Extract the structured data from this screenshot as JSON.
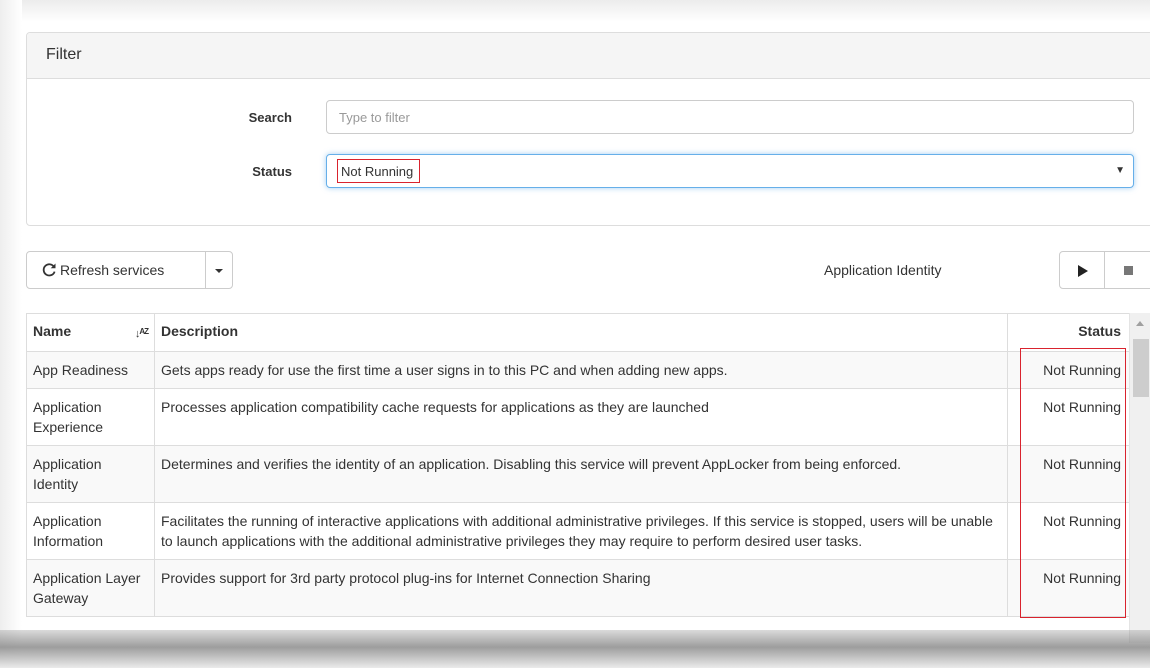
{
  "filter": {
    "title": "Filter",
    "search_label": "Search",
    "search_placeholder": "Type to filter",
    "search_value": "",
    "status_label": "Status",
    "status_value": "Not Running"
  },
  "toolbar": {
    "refresh_label": "Refresh services",
    "selected_service": "Application Identity",
    "play_icon": "play-icon",
    "stop_icon": "stop-icon"
  },
  "table": {
    "headers": {
      "name": "Name",
      "description": "Description",
      "status": "Status"
    },
    "rows": [
      {
        "name": "App Readiness",
        "description": "Gets apps ready for use the first time a user signs in to this PC and when adding new apps.",
        "status": "Not Running"
      },
      {
        "name": "Application Experience",
        "description": "Processes application compatibility cache requests for applications as they are launched",
        "status": "Not Running"
      },
      {
        "name": "Application Identity",
        "description": "Determines and verifies the identity of an application. Disabling this service will prevent AppLocker from being enforced.",
        "status": "Not Running"
      },
      {
        "name": "Application Information",
        "description": "Facilitates the running of interactive applications with additional administrative privileges. If this service is stopped, users will be unable to launch applications with the additional administrative privileges they may require to perform desired user tasks.",
        "status": "Not Running"
      },
      {
        "name": "Application Layer Gateway",
        "description": "Provides support for 3rd party protocol plug-ins for Internet Connection Sharing",
        "status": "Not Running"
      }
    ]
  },
  "colors": {
    "highlight": "#d9232e",
    "focus": "#66afe9",
    "border": "#dddddd"
  }
}
